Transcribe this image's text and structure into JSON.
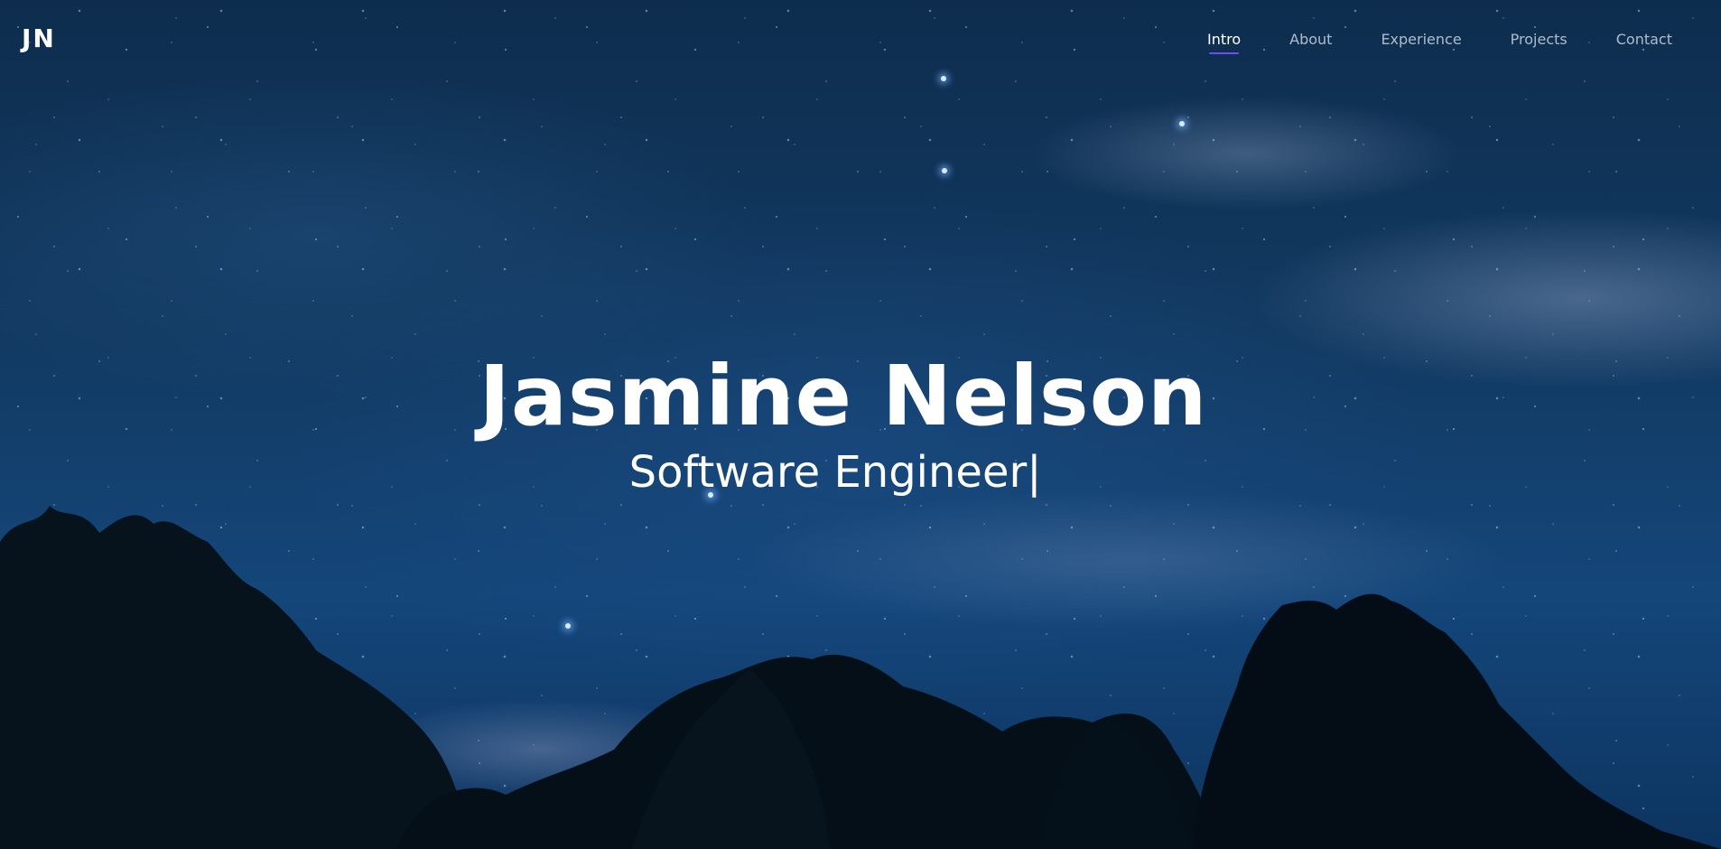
{
  "header": {
    "logo": "JN",
    "nav": [
      {
        "label": "Intro",
        "active": true
      },
      {
        "label": "About",
        "active": false
      },
      {
        "label": "Experience",
        "active": false
      },
      {
        "label": "Projects",
        "active": false
      },
      {
        "label": "Contact",
        "active": false
      }
    ],
    "accent_color": "#6e4cf2"
  },
  "hero": {
    "name": "Jasmine Nelson",
    "role": "Software Engineer",
    "cursor": "|"
  }
}
